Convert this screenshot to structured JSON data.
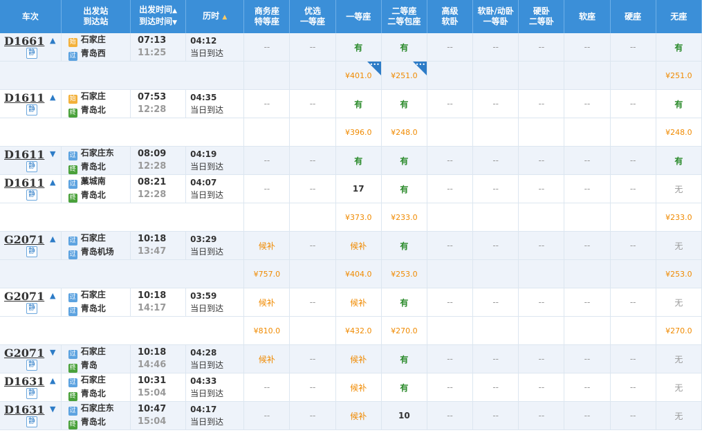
{
  "headers": {
    "train": "车次",
    "station_top": "出发站",
    "station_bottom": "到达站",
    "time_top": "出发时间",
    "time_bottom": "到达时间",
    "duration": "历时",
    "business_top": "商务座",
    "business_bottom": "特等座",
    "premium_top": "优选",
    "premium_bottom": "一等座",
    "first": "一等座",
    "second_top": "二等座",
    "second_bottom": "二等包座",
    "hsoft_top": "高级",
    "hsoft_bottom": "软卧",
    "soft_sleep_top": "软卧/动卧",
    "soft_sleep_bottom": "一等卧",
    "hard_sleep_top": "硬卧",
    "hard_sleep_bottom": "二等卧",
    "soft_seat": "软座",
    "hard_seat": "硬座",
    "no_seat": "无座",
    "sort_up": "▲",
    "sort_down": "▼"
  },
  "labels": {
    "jing": "静",
    "dash": "--"
  },
  "trains": [
    {
      "no": "D1661",
      "dir": "▲",
      "from": "石家庄",
      "from_badge": "始",
      "to": "青岛西",
      "to_badge": "过",
      "dep": "07:13",
      "arr": "11:25",
      "dur": "04:12",
      "day": "当日到达",
      "seats": [
        "--",
        "--",
        "有",
        "有",
        "--",
        "--",
        "--",
        "--",
        "--",
        "有"
      ],
      "prices": [
        "",
        "",
        "¥401.0",
        "¥251.0",
        "",
        "",
        "",
        "",
        "",
        "¥251.0"
      ],
      "alt": true
    },
    {
      "no": "D1611",
      "dir": "▲",
      "from": "石家庄",
      "from_badge": "始",
      "to": "青岛北",
      "to_badge": "终",
      "dep": "07:53",
      "arr": "12:28",
      "dur": "04:35",
      "day": "当日到达",
      "seats": [
        "--",
        "--",
        "有",
        "有",
        "--",
        "--",
        "--",
        "--",
        "--",
        "有"
      ],
      "prices": [
        "",
        "",
        "¥396.0",
        "¥248.0",
        "",
        "",
        "",
        "",
        "",
        "¥248.0"
      ],
      "alt": false
    },
    {
      "no": "D1611",
      "dir": "▼",
      "from": "石家庄东",
      "from_badge": "过",
      "to": "青岛北",
      "to_badge": "终",
      "dep": "08:09",
      "arr": "12:28",
      "dur": "04:19",
      "day": "当日到达",
      "seats": [
        "--",
        "--",
        "有",
        "有",
        "--",
        "--",
        "--",
        "--",
        "--",
        "有"
      ],
      "prices": null,
      "alt": true
    },
    {
      "no": "D1611",
      "dir": "▲",
      "from": "藁城南",
      "from_badge": "过",
      "to": "青岛北",
      "to_badge": "终",
      "dep": "08:21",
      "arr": "12:28",
      "dur": "04:07",
      "day": "当日到达",
      "seats": [
        "--",
        "--",
        "17",
        "有",
        "--",
        "--",
        "--",
        "--",
        "--",
        "无"
      ],
      "prices": [
        "",
        "",
        "¥373.0",
        "¥233.0",
        "",
        "",
        "",
        "",
        "",
        "¥233.0"
      ],
      "alt": false
    },
    {
      "no": "G2071",
      "dir": "▲",
      "from": "石家庄",
      "from_badge": "过",
      "to": "青岛机场",
      "to_badge": "过",
      "dep": "10:18",
      "arr": "13:47",
      "dur": "03:29",
      "day": "当日到达",
      "seats": [
        "候补",
        "--",
        "候补",
        "有",
        "--",
        "--",
        "--",
        "--",
        "--",
        "无"
      ],
      "prices": [
        "¥757.0",
        "",
        "¥404.0",
        "¥253.0",
        "",
        "",
        "",
        "",
        "",
        "¥253.0"
      ],
      "alt": true
    },
    {
      "no": "G2071",
      "dir": "▲",
      "from": "石家庄",
      "from_badge": "过",
      "to": "青岛北",
      "to_badge": "过",
      "dep": "10:18",
      "arr": "14:17",
      "dur": "03:59",
      "day": "当日到达",
      "seats": [
        "候补",
        "--",
        "候补",
        "有",
        "--",
        "--",
        "--",
        "--",
        "--",
        "无"
      ],
      "prices": [
        "¥810.0",
        "",
        "¥432.0",
        "¥270.0",
        "",
        "",
        "",
        "",
        "",
        "¥270.0"
      ],
      "alt": false
    },
    {
      "no": "G2071",
      "dir": "▼",
      "from": "石家庄",
      "from_badge": "过",
      "to": "青岛",
      "to_badge": "终",
      "dep": "10:18",
      "arr": "14:46",
      "dur": "04:28",
      "day": "当日到达",
      "seats": [
        "候补",
        "--",
        "候补",
        "有",
        "--",
        "--",
        "--",
        "--",
        "--",
        "无"
      ],
      "prices": null,
      "alt": true
    },
    {
      "no": "D1631",
      "dir": "▲",
      "from": "石家庄",
      "from_badge": "过",
      "to": "青岛北",
      "to_badge": "终",
      "dep": "10:31",
      "arr": "15:04",
      "dur": "04:33",
      "day": "当日到达",
      "seats": [
        "--",
        "--",
        "候补",
        "有",
        "--",
        "--",
        "--",
        "--",
        "--",
        "无"
      ],
      "prices": null,
      "alt": false
    },
    {
      "no": "D1631",
      "dir": "▼",
      "from": "石家庄东",
      "from_badge": "过",
      "to": "青岛北",
      "to_badge": "终",
      "dep": "10:47",
      "arr": "15:04",
      "dur": "04:17",
      "day": "当日到达",
      "seats": [
        "--",
        "--",
        "候补",
        "10",
        "--",
        "--",
        "--",
        "--",
        "--",
        "无"
      ],
      "prices": null,
      "alt": true
    }
  ]
}
